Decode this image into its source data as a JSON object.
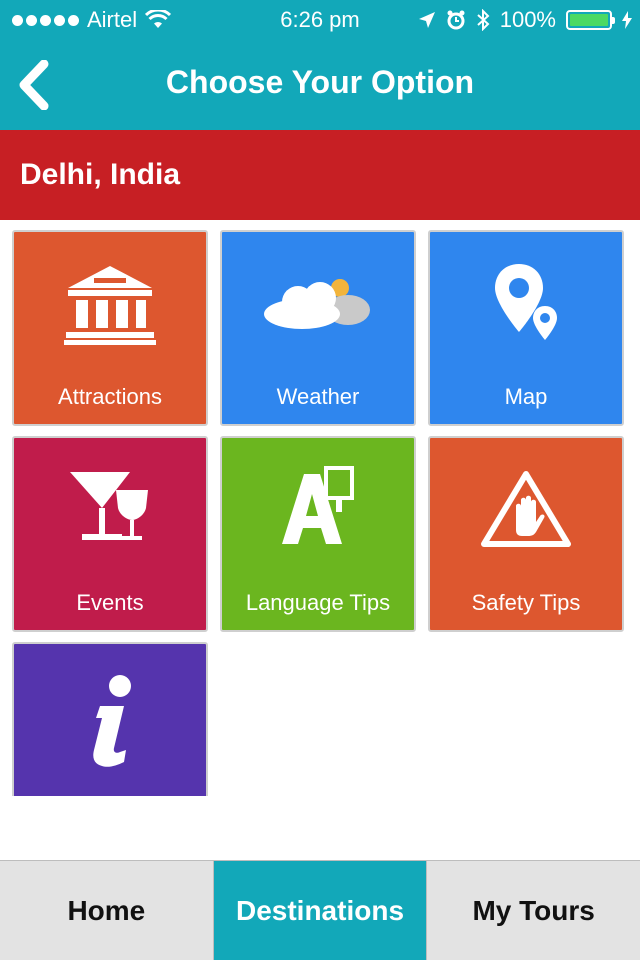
{
  "status_bar": {
    "carrier": "Airtel",
    "time": "6:26 pm",
    "battery": "100%"
  },
  "nav": {
    "title": "Choose Your Option"
  },
  "city": {
    "name": "Delhi, India"
  },
  "options": [
    {
      "label": "Attractions",
      "icon": "museum-icon",
      "color": "#dd572f"
    },
    {
      "label": "Weather",
      "icon": "cloud-sun-icon",
      "color": "#2f86ee"
    },
    {
      "label": "Map",
      "icon": "map-pin-icon",
      "color": "#2f86ee"
    },
    {
      "label": "Events",
      "icon": "cocktail-icon",
      "color": "#c01c4b"
    },
    {
      "label": "Language Tips",
      "icon": "language-icon",
      "color": "#6bb61f"
    },
    {
      "label": "Safety Tips",
      "icon": "warning-hand-icon",
      "color": "#dd572f"
    },
    {
      "label": "",
      "icon": "info-icon",
      "color": "#5534ad"
    }
  ],
  "tabs": [
    {
      "label": "Home",
      "active": false
    },
    {
      "label": "Destinations",
      "active": true
    },
    {
      "label": "My Tours",
      "active": false
    }
  ],
  "colors": {
    "teal": "#12a8b9",
    "red_bar": "#c71f24"
  }
}
